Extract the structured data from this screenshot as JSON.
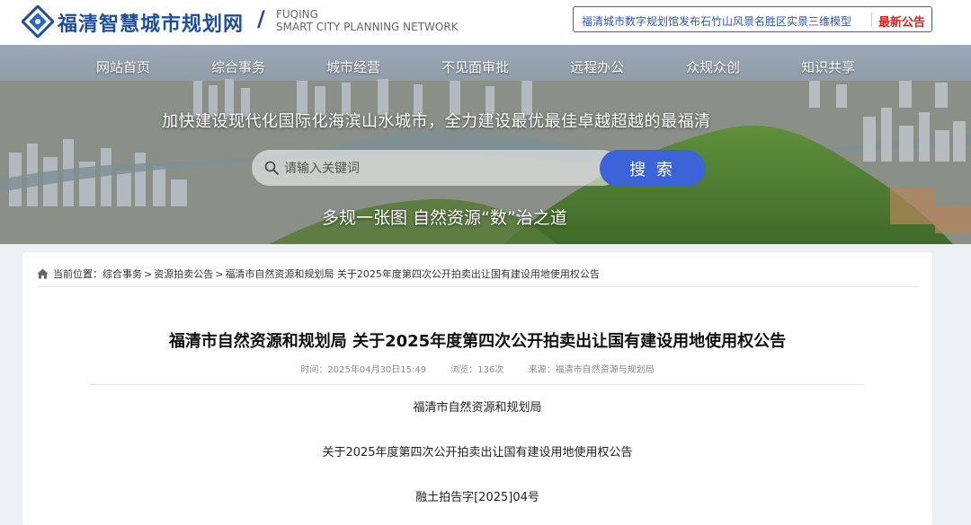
{
  "header": {
    "site_title": "福清智慧城市规划网",
    "site_title_en_line1": "FUQING",
    "site_title_en_line2": "SMART CITY PLANNING NETWORK",
    "notice_text": "福清城市数字规划馆发布石竹山风景名胜区实景三维模型",
    "notice_tag": "最新公告"
  },
  "nav": {
    "items": [
      "网站首页",
      "综合事务",
      "城市经营",
      "不见面审批",
      "远程办公",
      "众规众创",
      "知识共享"
    ]
  },
  "banner": {
    "slogan": "加快建设现代化国际化海滨山水城市，全力建设最优最佳卓越超越的最福清",
    "search_placeholder": "请输入关键词",
    "search_button": "搜 索",
    "tagline": "多规一张图  自然资源“数”治之道"
  },
  "breadcrumb": {
    "prefix": "当前位置：",
    "items": [
      "综合事务",
      "资源拍卖公告",
      "福清市自然资源和规划局 关于2025年度第四次公开拍卖出让国有建设用地使用权公告"
    ],
    "separator": ">"
  },
  "article": {
    "title": "福清市自然资源和规划局 关于2025年度第四次公开拍卖出让国有建设用地使用权公告",
    "time": "时间：2025年04月30日15:49",
    "views": "浏览：136次",
    "source": "来源：福清市自然资源与规划局",
    "paragraphs": [
      "福清市自然资源和规划局",
      "关于2025年度第四次公开拍卖出让国有建设用地使用权公告",
      "融土拍告字[2025]04号"
    ]
  },
  "colors": {
    "brand": "#1f4f9b",
    "accent": "#3d63d8",
    "alert": "#e02020"
  }
}
